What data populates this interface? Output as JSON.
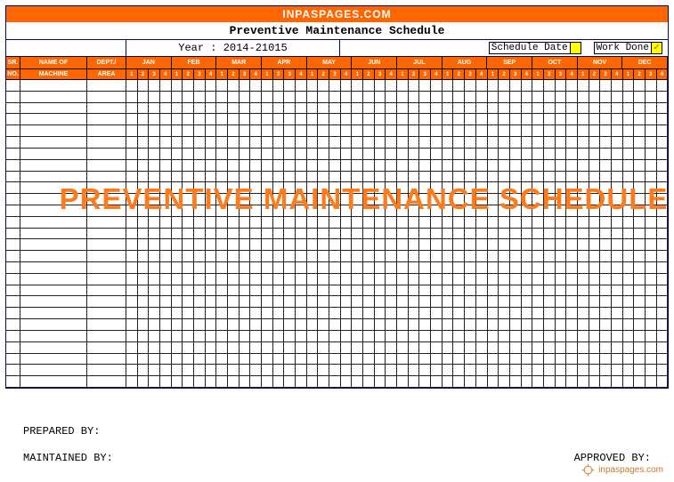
{
  "site": "INPASPAGES.COM",
  "title": "Preventive Maintenance Schedule",
  "year_label": "Year : 2014-21015",
  "legend": {
    "schedule": "Schedule Date",
    "done": "Work Done",
    "done_mark": "✓"
  },
  "headers": {
    "sr": "SR. NO.",
    "name": "NAME OF MACHINE",
    "dept": "DEPT./ AREA"
  },
  "months": [
    "JAN",
    "FEB",
    "MAR",
    "APR",
    "MAY",
    "JUN",
    "JUL",
    "AUG",
    "SEP",
    "OCT",
    "NOV",
    "DEC"
  ],
  "weeks": [
    "1",
    "2",
    "3",
    "4"
  ],
  "row_count": 27,
  "watermark": "PREVENTIVE MAINTENANCE SCHEDULE",
  "footer": {
    "prepared": "PREPARED BY:",
    "maintained": "MAINTAINED BY:",
    "approved": "APPROVED BY:"
  },
  "brand_text": "inpaspages.com"
}
